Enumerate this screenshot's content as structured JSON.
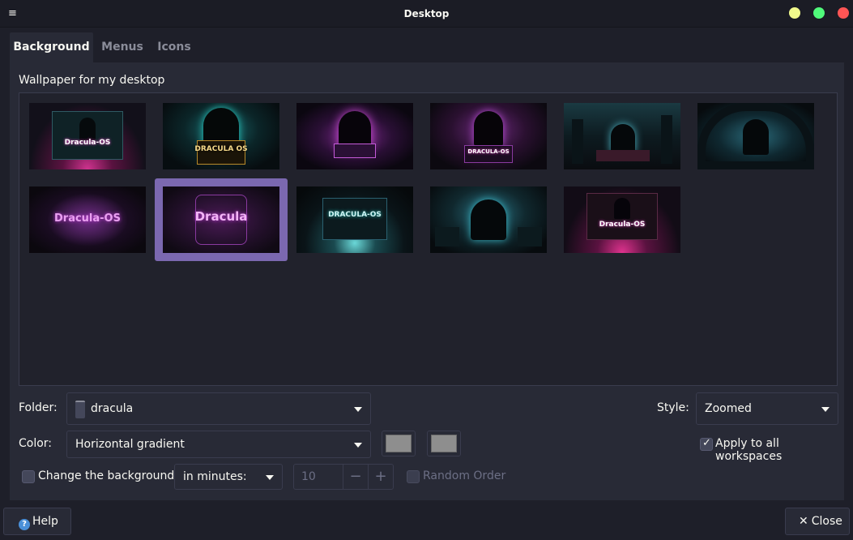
{
  "window": {
    "title": "Desktop",
    "menu_glyph": "≡"
  },
  "tabs": [
    {
      "label": "Background",
      "active": true
    },
    {
      "label": "Menus",
      "active": false
    },
    {
      "label": "Icons",
      "active": false
    }
  ],
  "background": {
    "section_title": "Wallpaper for my desktop",
    "thumbnails": [
      {
        "caption": "Dracula-OS",
        "theme": "pink-laptop"
      },
      {
        "caption": "DRACULA OS",
        "theme": "teal-hooded"
      },
      {
        "caption": "",
        "theme": "purple-hooded"
      },
      {
        "caption": "DRACULA-OS",
        "theme": "purple-hooded-2"
      },
      {
        "caption": "",
        "theme": "teal-city"
      },
      {
        "caption": "",
        "theme": "teal-castle"
      },
      {
        "caption": "Dracula-OS",
        "theme": "purple-bat"
      },
      {
        "caption": "Dracula",
        "theme": "purple-emblem",
        "selected": true
      },
      {
        "caption": "DRACULA-OS",
        "theme": "teal-laptop"
      },
      {
        "caption": "",
        "theme": "teal-gothic"
      },
      {
        "caption": "Dracula-OS",
        "theme": "pink-laptop-2"
      }
    ],
    "folder_label": "Folder:",
    "folder_value": "dracula",
    "style_label": "Style:",
    "style_value": "Zoomed",
    "color_label": "Color:",
    "color_value": "Horizontal gradient",
    "color1": "#8e8e8e",
    "color2": "#8e8e8e",
    "apply_all_label": "Apply to all workspaces",
    "apply_all_checked": true,
    "change_bg_label": "Change the background",
    "change_bg_checked": false,
    "interval_value": "in minutes:",
    "interval_number": "10",
    "random_order_label": "Random Order",
    "random_order_checked": false
  },
  "footer": {
    "help_label": "Help",
    "close_label": "Close"
  },
  "colors": {
    "window_bg": "#1e1f29",
    "panel_bg": "#282a36",
    "accent_selection": "#7b68b0",
    "close_button": "#ff5555",
    "maximize_button": "#50fa7b",
    "minimize_button": "#f1fa8c"
  }
}
